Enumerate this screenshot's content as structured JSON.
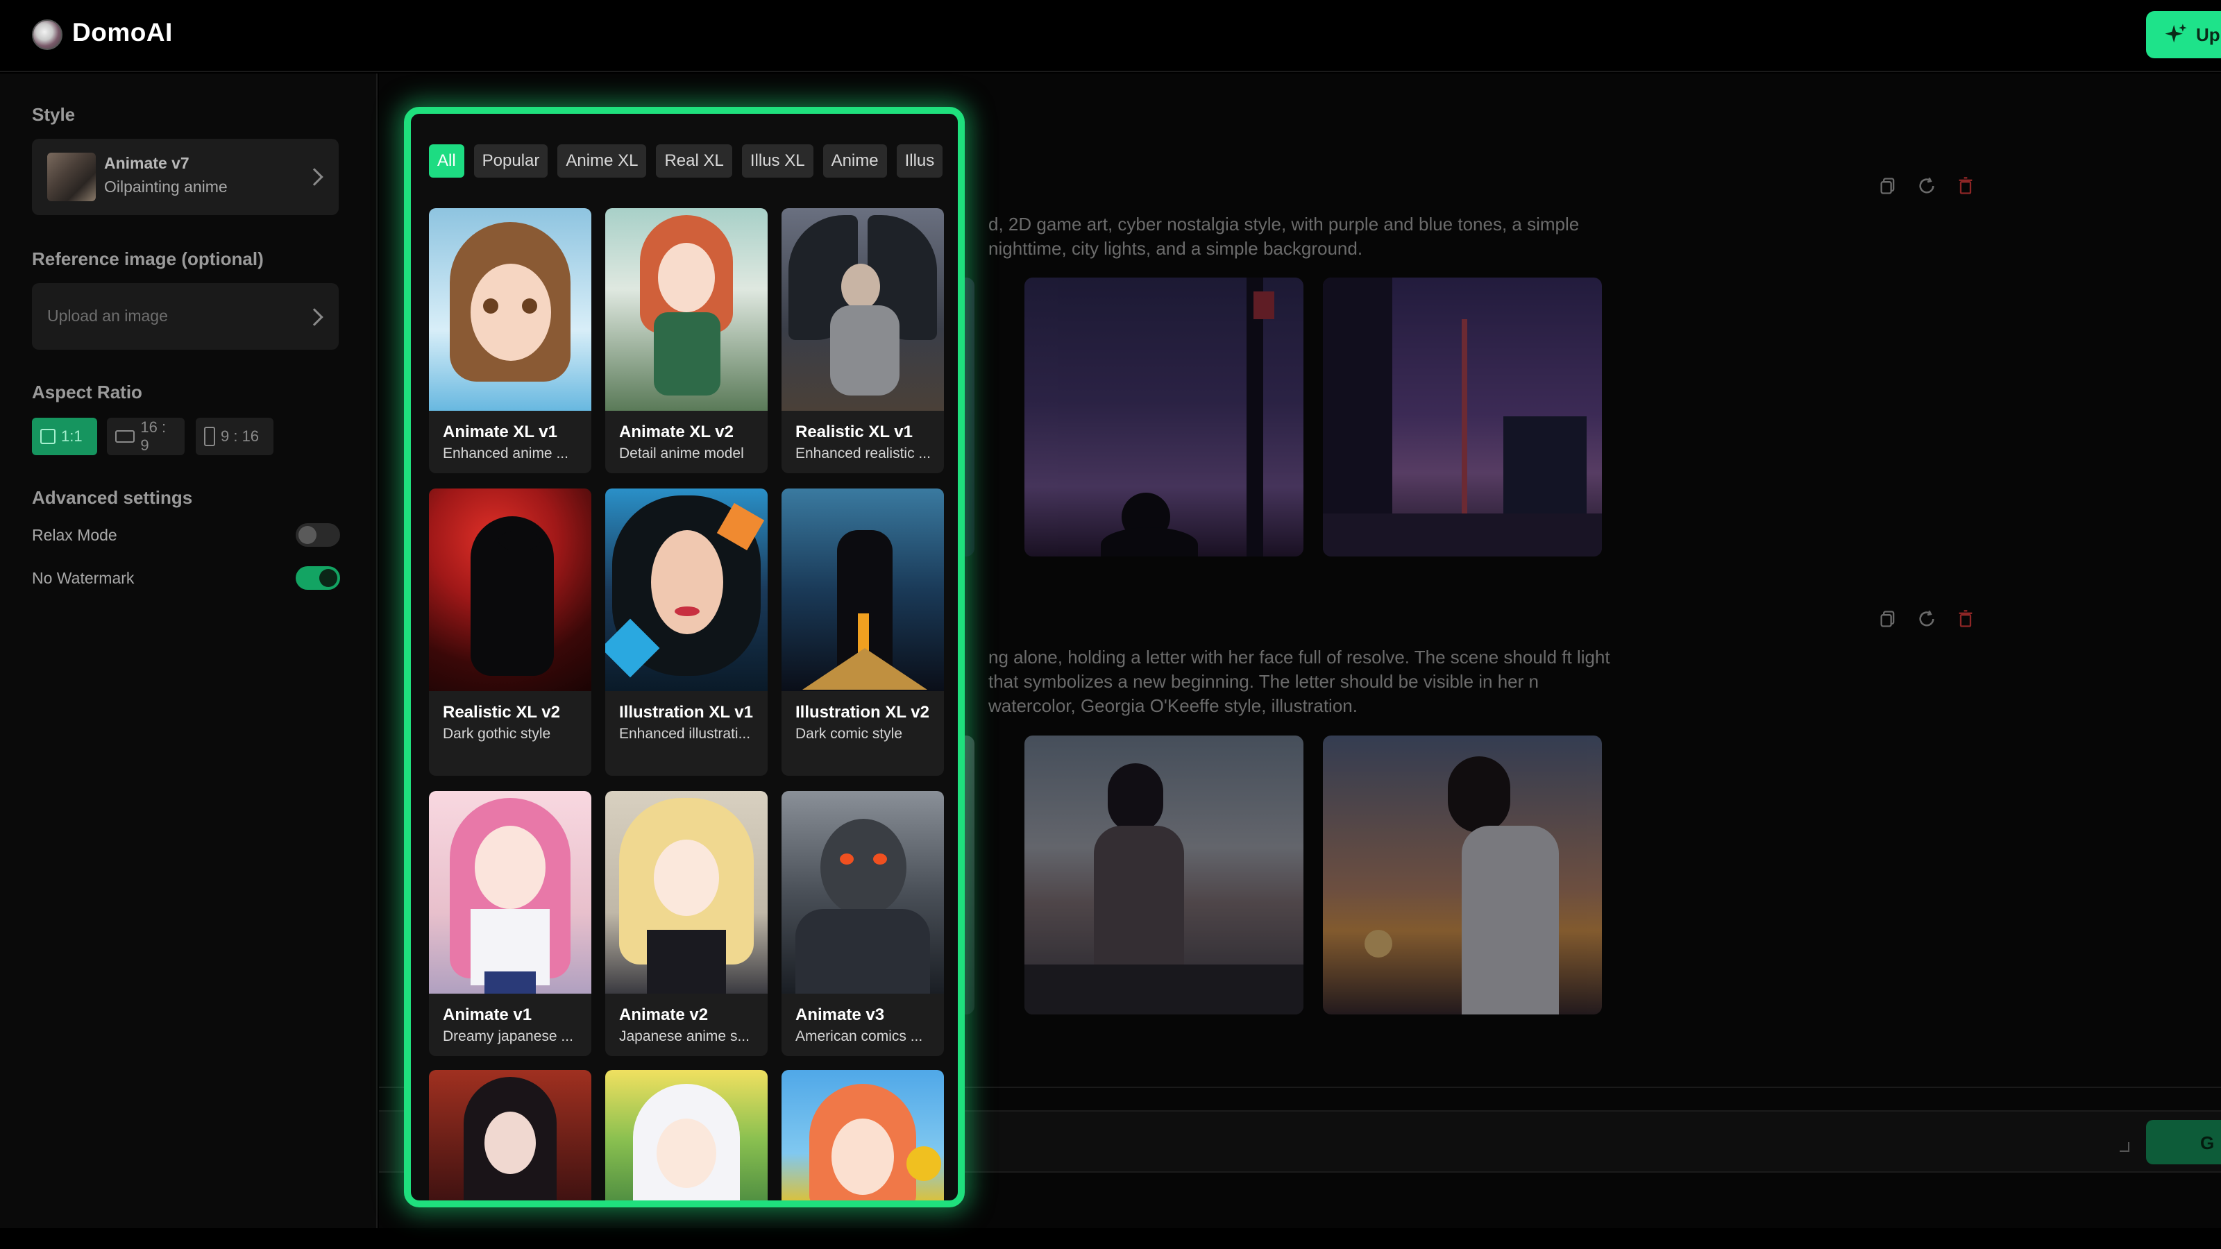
{
  "app": {
    "brand": "DomoAI",
    "upgrade_label": "Up",
    "generate_label": "G"
  },
  "sidebar": {
    "style_label": "Style",
    "style_name": "Animate v7",
    "style_sub": "Oilpainting anime",
    "reference_label": "Reference image (optional)",
    "upload_placeholder": "Upload an image",
    "aspect_label": "Aspect Ratio",
    "ratios": [
      "1:1",
      "16 : 9",
      "9 : 16"
    ],
    "advanced_label": "Advanced settings",
    "relax_mode": "Relax Mode",
    "no_watermark": "No Watermark"
  },
  "colors": {
    "accent": "#1fe07d",
    "sidebar_bg": "#0a0a0a",
    "delete_red": "#b23030"
  },
  "main": {
    "prompt1": "d, 2D game art, cyber nostalgia style, with purple and blue tones, a simple nighttime, city lights, and a simple background.",
    "prompt2": "ng alone, holding a letter with her face full of resolve. The scene should ft light that symbolizes a new beginning. The letter should be visible in her n watercolor, Georgia O'Keeffe style, illustration."
  },
  "picker": {
    "tabs": [
      "All",
      "Popular",
      "Anime XL",
      "Real XL",
      "Illus XL",
      "Anime",
      "Illus"
    ],
    "cards": [
      {
        "title": "Animate XL v1",
        "desc": "Enhanced anime ..."
      },
      {
        "title": "Animate XL v2",
        "desc": "Detail anime model"
      },
      {
        "title": "Realistic XL v1",
        "desc": "Enhanced realistic ..."
      },
      {
        "title": "Realistic XL v2",
        "desc": "Dark gothic style"
      },
      {
        "title": "Illustration XL v1",
        "desc": "Enhanced illustrati..."
      },
      {
        "title": "Illustration XL v2",
        "desc": "Dark comic style"
      },
      {
        "title": "Animate v1",
        "desc": "Dreamy japanese ..."
      },
      {
        "title": "Animate v2",
        "desc": "Japanese anime s..."
      },
      {
        "title": "Animate v3",
        "desc": "American comics ..."
      },
      {
        "title": "",
        "desc": ""
      },
      {
        "title": "",
        "desc": ""
      },
      {
        "title": "",
        "desc": ""
      }
    ]
  }
}
